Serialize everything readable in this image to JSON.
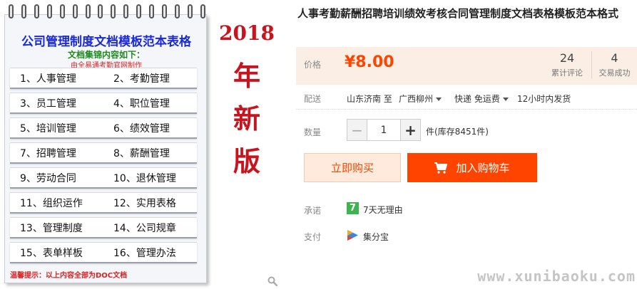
{
  "product_image": {
    "notepad_title": "公司管理制度文档模板范本表格",
    "subtitle": "文档集锦内容如下：",
    "credit": "由全易通考勤官网制作",
    "items": [
      [
        "1、人事管理",
        "2、考勤管理"
      ],
      [
        "3、员工管理",
        "4、职位管理"
      ],
      [
        "5、培训管理",
        "6、绩效管理"
      ],
      [
        "7、招聘管理",
        "8、薪酬管理"
      ],
      [
        "9、劳动合同",
        "10、退休管理"
      ],
      [
        "11、组织运作",
        "12、实用表格"
      ],
      [
        "13、管理制度",
        "14、公司规章"
      ],
      [
        "15、表单样板",
        "16、管理办法"
      ]
    ],
    "tip": "温馨提示：以上内容全部为DOC文档",
    "edition_year": "2018",
    "edition_chars": [
      "年",
      "新",
      "版"
    ],
    "zoom_icon": "magnifier-icon"
  },
  "product": {
    "title": "人事考勤薪酬招聘培训绩效考核合同管理制度文档表格模板范本格式",
    "price_label": "价格",
    "price": "¥8.00",
    "reviews_count": "24",
    "reviews_label": "累计评论",
    "sales_count": "4",
    "sales_label": "交易成功",
    "shipping_label": "配送",
    "ship_from": "山东济南 至",
    "ship_to": "广西柳州",
    "ship_method": "快递 免运费",
    "ship_time": "12小时内发货",
    "quantity_label": "数量",
    "quantity_value": "1",
    "minus_symbol": "−",
    "plus_symbol": "+",
    "stock": "件(库存8451件)",
    "buy_now": "立即购买",
    "add_to_cart": "加入购物车",
    "promise_label": "承诺",
    "promise_badge": "7",
    "promise_text": "7天无理由",
    "pay_label": "支付",
    "pay_text": "集分宝"
  },
  "watermark": "www.xunibaoku.com",
  "colors": {
    "accent": "#ff4400",
    "price_bg": "#fbeee4",
    "buy_now_bg": "#ffeadb",
    "notepad_title": "#1a2ad6",
    "edition": "#c8141e",
    "promise_badge": "#3fb34f"
  }
}
